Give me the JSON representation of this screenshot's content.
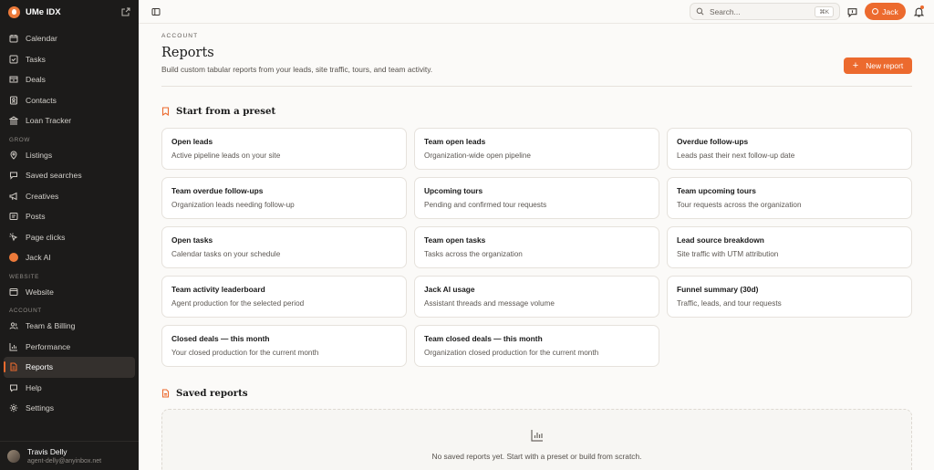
{
  "app": {
    "name": "UMe IDX"
  },
  "sidebar": {
    "main_items": [
      {
        "label": "Calendar",
        "icon": "calendar-icon"
      },
      {
        "label": "Tasks",
        "icon": "checkbox-icon"
      },
      {
        "label": "Deals",
        "icon": "deals-icon"
      },
      {
        "label": "Contacts",
        "icon": "contacts-icon"
      },
      {
        "label": "Loan Tracker",
        "icon": "bank-icon"
      }
    ],
    "sections": {
      "grow": "GROW",
      "website": "WEBSITE",
      "account": "ACCOUNT"
    },
    "grow_items": [
      {
        "label": "Listings",
        "icon": "pin-icon"
      },
      {
        "label": "Saved searches",
        "icon": "search-icon"
      },
      {
        "label": "Creatives",
        "icon": "megaphone-icon"
      },
      {
        "label": "Posts",
        "icon": "post-icon"
      },
      {
        "label": "Page clicks",
        "icon": "cursor-icon"
      },
      {
        "label": "Jack AI",
        "icon": "jack-ai-icon"
      }
    ],
    "website_items": [
      {
        "label": "Website",
        "icon": "window-icon"
      }
    ],
    "account_items": [
      {
        "label": "Team & Billing",
        "icon": "team-icon"
      },
      {
        "label": "Performance",
        "icon": "bar-chart-icon"
      },
      {
        "label": "Reports",
        "icon": "report-icon",
        "active": true
      },
      {
        "label": "Help",
        "icon": "help-icon"
      },
      {
        "label": "Settings",
        "icon": "gear-icon"
      }
    ],
    "user": {
      "name": "Travis Delly",
      "email": "agent-delly@anyinbox.net"
    }
  },
  "topbar": {
    "search_placeholder": "Search...",
    "search_shortcut": "⌘K",
    "user_button": "Jack"
  },
  "page": {
    "eyebrow": "ACCOUNT",
    "title": "Reports",
    "subtitle": "Build custom tabular reports from your leads, site traffic, tours, and team activity.",
    "new_button": "New report",
    "presets_title": "Start from a preset",
    "presets": [
      {
        "title": "Open leads",
        "desc": "Active pipeline leads on your site"
      },
      {
        "title": "Team open leads",
        "desc": "Organization-wide open pipeline"
      },
      {
        "title": "Overdue follow-ups",
        "desc": "Leads past their next follow-up date"
      },
      {
        "title": "Team overdue follow-ups",
        "desc": "Organization leads needing follow-up"
      },
      {
        "title": "Upcoming tours",
        "desc": "Pending and confirmed tour requests"
      },
      {
        "title": "Team upcoming tours",
        "desc": "Tour requests across the organization"
      },
      {
        "title": "Open tasks",
        "desc": "Calendar tasks on your schedule"
      },
      {
        "title": "Team open tasks",
        "desc": "Tasks across the organization"
      },
      {
        "title": "Lead source breakdown",
        "desc": "Site traffic with UTM attribution"
      },
      {
        "title": "Team activity leaderboard",
        "desc": "Agent production for the selected period"
      },
      {
        "title": "Jack AI usage",
        "desc": "Assistant threads and message volume"
      },
      {
        "title": "Funnel summary (30d)",
        "desc": "Traffic, leads, and tour requests"
      },
      {
        "title": "Closed deals — this month",
        "desc": "Your closed production for the current month"
      },
      {
        "title": "Team closed deals — this month",
        "desc": "Organization closed production for the current month"
      }
    ],
    "saved_title": "Saved reports",
    "saved_empty": "No saved reports yet. Start with a preset or build from scratch."
  },
  "colors": {
    "accent": "#ec6a2e",
    "sidebar_bg": "#1c1b1a",
    "page_bg": "#fbfaf8"
  }
}
